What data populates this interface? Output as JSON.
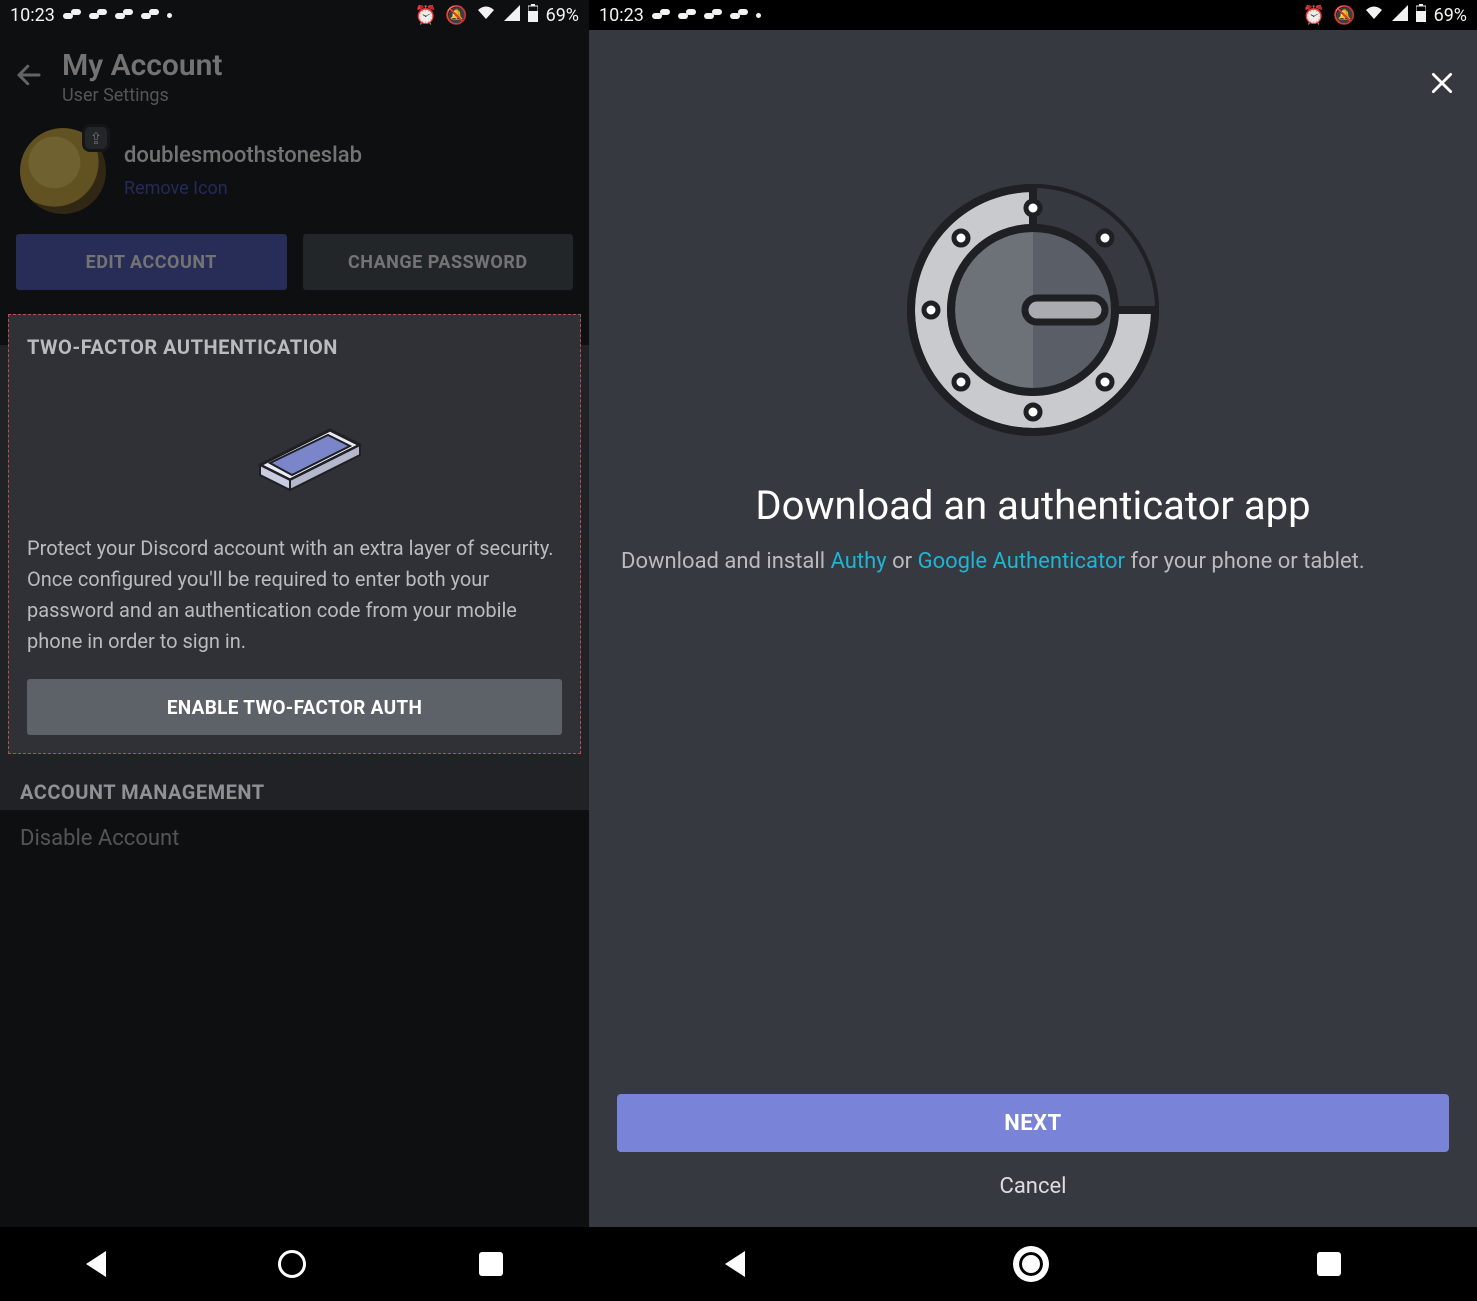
{
  "status": {
    "time": "10:23",
    "battery": "69%"
  },
  "left": {
    "title": "My Account",
    "subtitle": "User Settings",
    "username": "doublesmoothstoneslab",
    "remove_icon": "Remove Icon",
    "edit_account": "EDIT ACCOUNT",
    "change_password": "CHANGE PASSWORD",
    "twofa_title": "TWO-FACTOR AUTHENTICATION",
    "twofa_desc": "Protect your Discord account with an extra layer of security. Once configured you'll be required to enter both your password and an authentication code from your mobile phone in order to sign in.",
    "enable_label": "ENABLE TWO-FACTOR AUTH",
    "acct_mgmt": "ACCOUNT MANAGEMENT",
    "disable_account": "Disable Account"
  },
  "right": {
    "title": "Download an authenticator app",
    "desc_pre": "Download and install ",
    "authy": "Authy",
    "or": " or ",
    "gauth": "Google Authenticator",
    "desc_post": " for your phone or tablet.",
    "next": "NEXT",
    "cancel": "Cancel"
  }
}
